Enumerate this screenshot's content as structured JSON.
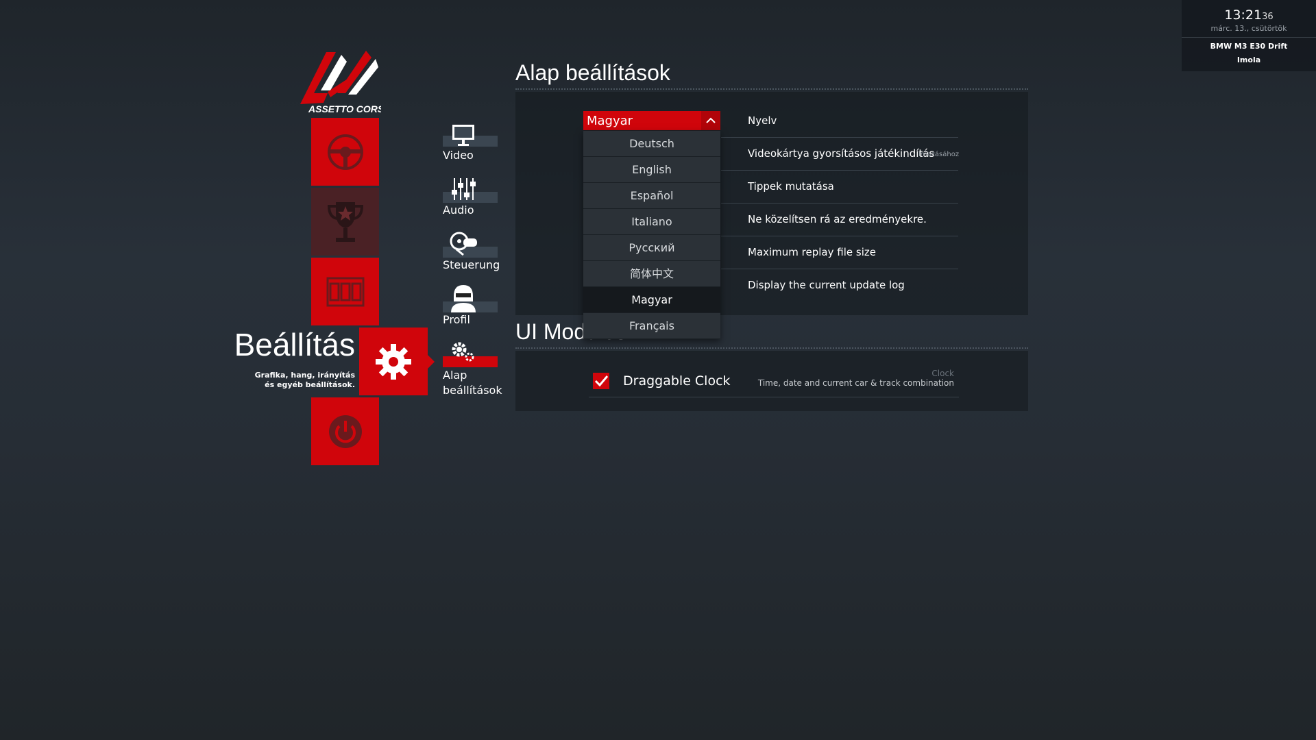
{
  "clock": {
    "time": "13:21",
    "seconds": "36",
    "date": "márc. 13., csütörtök",
    "car": "BMW M3 E30 Drift",
    "track": "Imola"
  },
  "logo": {
    "text": "ASSETTO CORSA"
  },
  "main_menu": {
    "active": {
      "title": "Beállítás",
      "subtitle_line1": "Grafika, hang, irányítás",
      "subtitle_line2": "és egyéb beállítások."
    }
  },
  "sub_menu": [
    {
      "label": "Video"
    },
    {
      "label": "Audio"
    },
    {
      "label": "Steuerung"
    },
    {
      "label": "Profil"
    },
    {
      "label_line1": "Alap",
      "label_line2": "beállítások"
    }
  ],
  "general": {
    "heading": "Alap beállítások",
    "rows": [
      {
        "label": "Nyelv"
      },
      {
        "label": "Videokártya gyorsításos játékindítás",
        "overflow": "lmazásához"
      },
      {
        "label": "Tippek mutatása"
      },
      {
        "label": "Ne közelítsen rá az eredményekre."
      },
      {
        "label": "Maximum replay file size"
      },
      {
        "label": "Display the current update log"
      }
    ]
  },
  "language_dropdown": {
    "selected": "Magyar",
    "options": [
      "Deutsch",
      "English",
      "Español",
      "Italiano",
      "Русский",
      "简体中文",
      "Magyar",
      "Français"
    ]
  },
  "ui_modules": {
    "heading": "UI Modules",
    "items": [
      {
        "label": "Draggable Clock",
        "checked": true,
        "title": "Clock",
        "description": "Time, date and current car & track combination"
      }
    ]
  },
  "colors": {
    "accent": "#d0050b",
    "background": "#262d35"
  }
}
